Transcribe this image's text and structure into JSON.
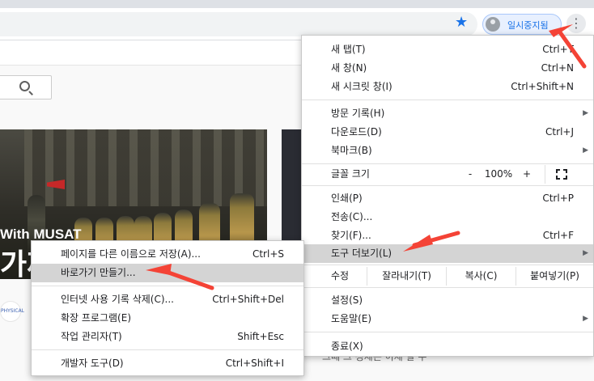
{
  "browser": {
    "profile_label": "일시중지됨",
    "accent": "#1a73e8",
    "menu_icon": "kebab-menu-icon",
    "bookmark_icon": "star-icon"
  },
  "page": {
    "thumbnail_caption": "With MUSAT",
    "thumbnail_title": "가짜",
    "channel_logo_text": "PHYSICAL",
    "bottom_text": "그때 그 정체는 이제 알 수"
  },
  "chrome_menu": {
    "new_tab": {
      "label": "새 탭(T)",
      "shortcut": "Ctrl+T"
    },
    "new_window": {
      "label": "새 창(N)",
      "shortcut": "Ctrl+N"
    },
    "incognito": {
      "label": "새 시크릿 창(I)",
      "shortcut": "Ctrl+Shift+N"
    },
    "history": {
      "label": "방문 기록(H)"
    },
    "downloads": {
      "label": "다운로드(D)",
      "shortcut": "Ctrl+J"
    },
    "bookmarks": {
      "label": "북마크(B)"
    },
    "zoom": {
      "label": "글꼴 크기",
      "minus": "-",
      "value": "100%",
      "plus": "+"
    },
    "print": {
      "label": "인쇄(P)",
      "shortcut": "Ctrl+P"
    },
    "cast": {
      "label": "전송(C)..."
    },
    "find": {
      "label": "찾기(F)...",
      "shortcut": "Ctrl+F"
    },
    "more_tools": {
      "label": "도구 더보기(L)"
    },
    "edit": {
      "label": "수정",
      "cut": "잘라내기(T)",
      "copy": "복사(C)",
      "paste": "붙여넣기(P)"
    },
    "settings": {
      "label": "설정(S)"
    },
    "help": {
      "label": "도움말(E)"
    },
    "exit": {
      "label": "종료(X)"
    }
  },
  "submenu": {
    "save_page": {
      "label": "페이지를 다른 이름으로 저장(A)...",
      "shortcut": "Ctrl+S"
    },
    "create_shortcut": {
      "label": "바로가기 만들기..."
    },
    "clear_data": {
      "label": "인터넷 사용 기록 삭제(C)...",
      "shortcut": "Ctrl+Shift+Del"
    },
    "extensions": {
      "label": "확장 프로그램(E)"
    },
    "task_manager": {
      "label": "작업 관리자(T)",
      "shortcut": "Shift+Esc"
    },
    "dev_tools": {
      "label": "개발자 도구(D)",
      "shortcut": "Ctrl+Shift+I"
    }
  },
  "annotation_color": "#f44336"
}
